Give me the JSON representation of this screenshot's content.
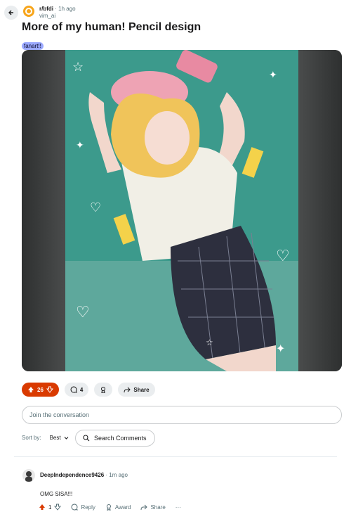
{
  "post": {
    "subreddit": "r/bfdi",
    "time": "· 1h ago",
    "username": "vim_ai",
    "title": "More of my human! Pencil design",
    "flair": "fanart!!"
  },
  "actions": {
    "votes": "26",
    "comments": "4",
    "share": "Share"
  },
  "reply": {
    "placeholder": "Join the conversation"
  },
  "sort": {
    "label": "Sort by:",
    "value": "Best"
  },
  "search": {
    "label": "Search Comments"
  },
  "comment": {
    "author": "DeepIndependence9426",
    "time": "· 1m ago",
    "body": "OMG SISA!!!",
    "votes": "1",
    "reply": "Reply",
    "award": "Award",
    "share": "Share",
    "more": "···"
  },
  "colors": {
    "upvote": "#d93a00",
    "pill_bg": "#eaedef",
    "flair_bg": "#9ba9ff",
    "art_bg": "#3c9a8c"
  }
}
